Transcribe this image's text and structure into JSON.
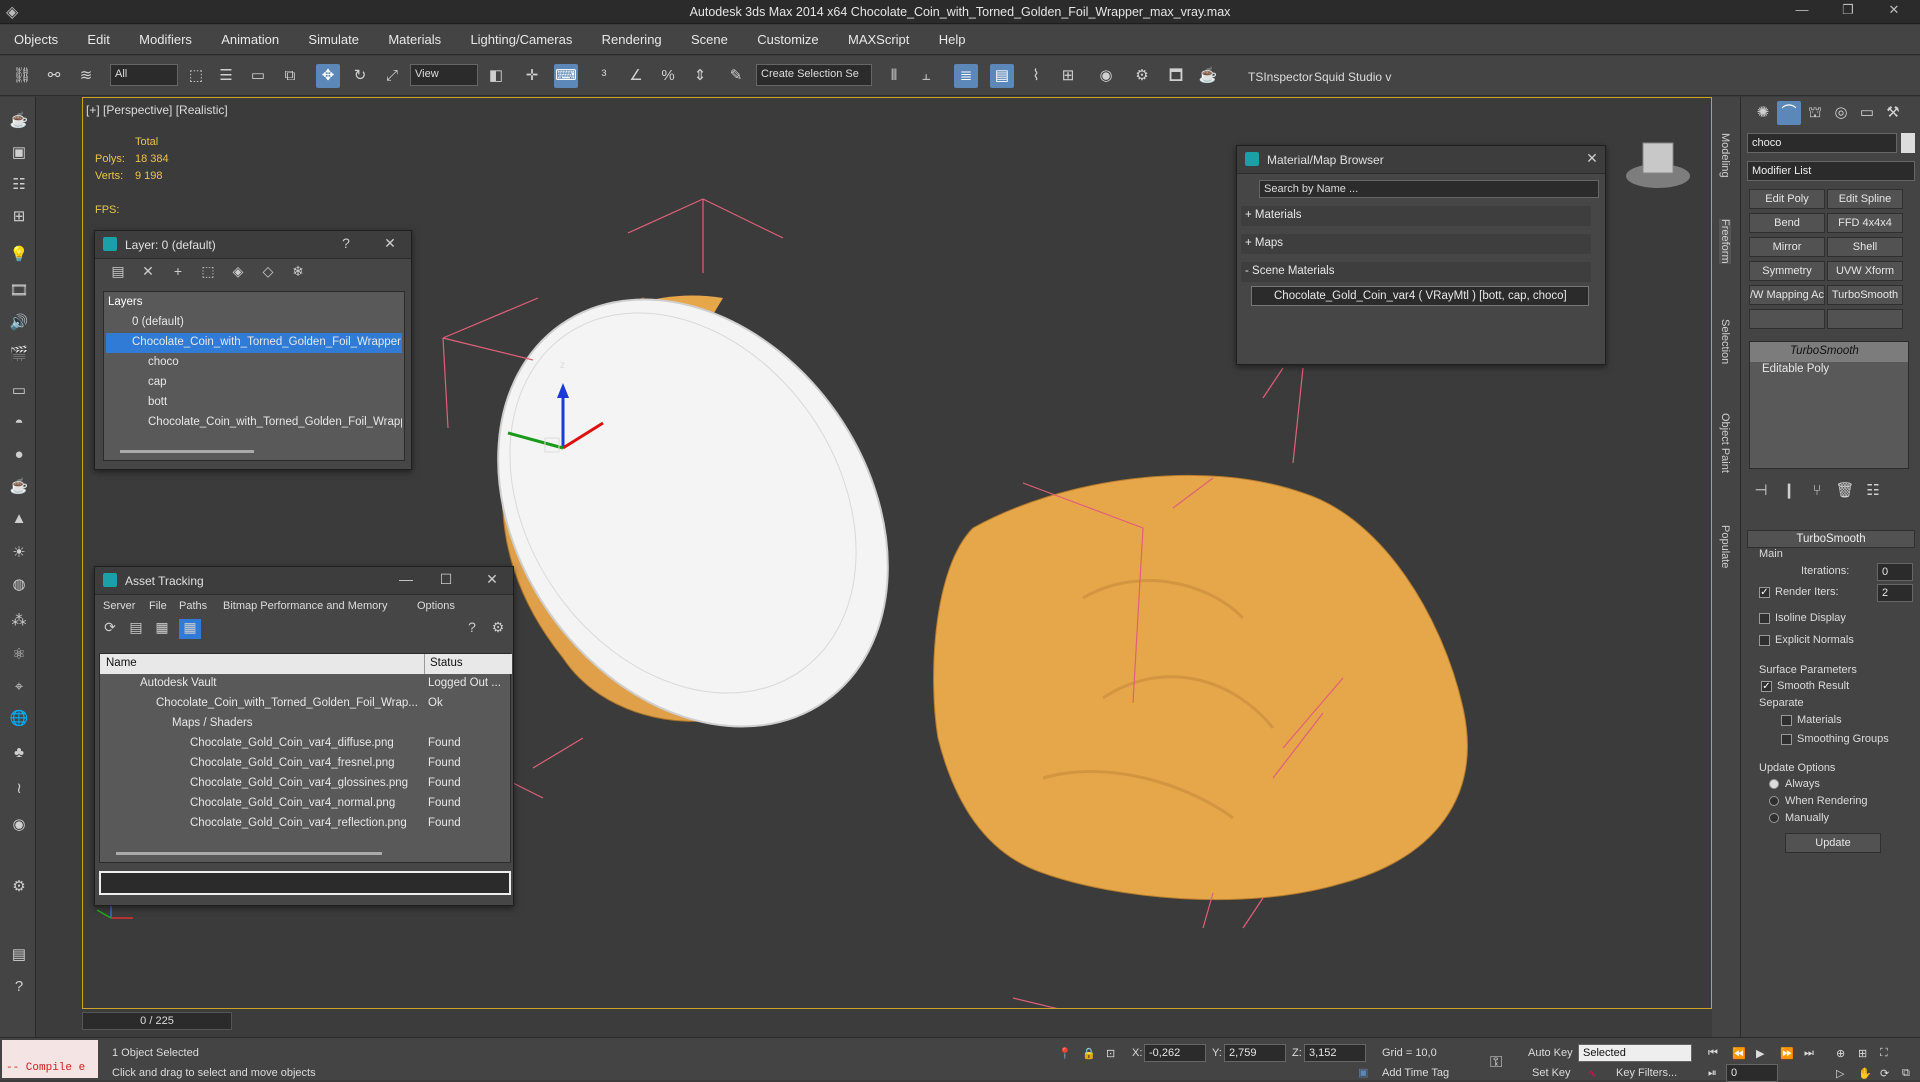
{
  "app": {
    "title": "Autodesk 3ds Max  2014 x64     Chocolate_Coin_with_Torned_Golden_Foil_Wrapper_max_vray.max"
  },
  "menu": [
    "Objects",
    "Edit",
    "Modifiers",
    "Animation",
    "Simulate",
    "Materials",
    "Lighting/Cameras",
    "Rendering",
    "Scene",
    "Customize",
    "MAXScript",
    "Help"
  ],
  "toolbar": {
    "filter_value": "All",
    "refcoord_value": "View",
    "selection_set_placeholder": "Create Selection Se",
    "tsinspector": "TSInspector",
    "squid": "Squid Studio v"
  },
  "viewport": {
    "label": "[+] [Perspective] [Realistic]",
    "stats_total": "Total",
    "polys_label": "Polys:",
    "polys_value": "18 384",
    "verts_label": "Verts:",
    "verts_value": "9 198",
    "fps_label": "FPS:",
    "gizmo_z": "z"
  },
  "layer_panel": {
    "title": "Layer: 0 (default)",
    "help": "?",
    "header": "Layers",
    "rows": [
      "0 (default)",
      "Chocolate_Coin_with_Torned_Golden_Foil_Wrapper",
      "choco",
      "cap",
      "bott",
      "Chocolate_Coin_with_Torned_Golden_Foil_Wrapper"
    ]
  },
  "material_browser": {
    "title": "Material/Map Browser",
    "search_placeholder": "Search by Name ...",
    "materials": "+ Materials",
    "maps": "+ Maps",
    "scene_materials": "- Scene Materials",
    "item": "Chocolate_Gold_Coin_var4  ( VRayMtl )  [bott, cap, choco]"
  },
  "asset_tracking": {
    "title": "Asset Tracking",
    "menu": [
      "Server",
      "File",
      "Paths",
      "Bitmap Performance and Memory",
      "Options"
    ],
    "col_name": "Name",
    "col_status": "Status",
    "rows": [
      {
        "name": "Autodesk Vault",
        "status": "Logged Out ..."
      },
      {
        "name": "Chocolate_Coin_with_Torned_Golden_Foil_Wrap...",
        "status": "Ok"
      },
      {
        "name": "Maps / Shaders",
        "status": ""
      },
      {
        "name": "Chocolate_Gold_Coin_var4_diffuse.png",
        "status": "Found"
      },
      {
        "name": "Chocolate_Gold_Coin_var4_fresnel.png",
        "status": "Found"
      },
      {
        "name": "Chocolate_Gold_Coin_var4_glossines.png",
        "status": "Found"
      },
      {
        "name": "Chocolate_Gold_Coin_var4_normal.png",
        "status": "Found"
      },
      {
        "name": "Chocolate_Gold_Coin_var4_reflection.png",
        "status": "Found"
      }
    ]
  },
  "side_tabs": [
    "Modeling",
    "Freeform",
    "Selection",
    "Object Paint",
    "Populate"
  ],
  "command_panel": {
    "object_name": "choco",
    "modifier_list": "Modifier List",
    "buttons": [
      "Edit Poly",
      "Edit Spline",
      "Bend",
      "FFD 4x4x4",
      "Mirror",
      "Shell",
      "Symmetry",
      "UVW Xform",
      "/W Mapping Ac",
      "TurboSmooth"
    ],
    "stack": [
      "TurboSmooth",
      "Editable Poly"
    ],
    "rollout_title": "TurboSmooth",
    "main": "Main",
    "iterations_label": "Iterations:",
    "iterations_value": "0",
    "render_iters_label": "Render Iters:",
    "render_iters_value": "2",
    "isoline": "Isoline Display",
    "explicit": "Explicit Normals",
    "surface_params": "Surface Parameters",
    "smooth_result": "Smooth Result",
    "separate": "Separate",
    "materials": "Materials",
    "smoothing_groups": "Smoothing Groups",
    "update_options": "Update Options",
    "always": "Always",
    "when_rendering": "When Rendering",
    "manually": "Manually",
    "update": "Update"
  },
  "status": {
    "timeline": "0 / 225",
    "maxscript": "-- Compile e",
    "selected": "1 Object Selected",
    "prompt": "Click and drag to select and move objects",
    "x_label": "X:",
    "x_value": "-0,262",
    "y_label": "Y:",
    "y_value": "2,759",
    "z_label": "Z:",
    "z_value": "3,152",
    "grid": "Grid = 10,0",
    "add_time_tag": "Add Time Tag",
    "auto_key": "Auto Key",
    "set_key": "Set Key",
    "selected_dropdown": "Selected",
    "key_filters": "Key Filters...",
    "frame": "0"
  }
}
